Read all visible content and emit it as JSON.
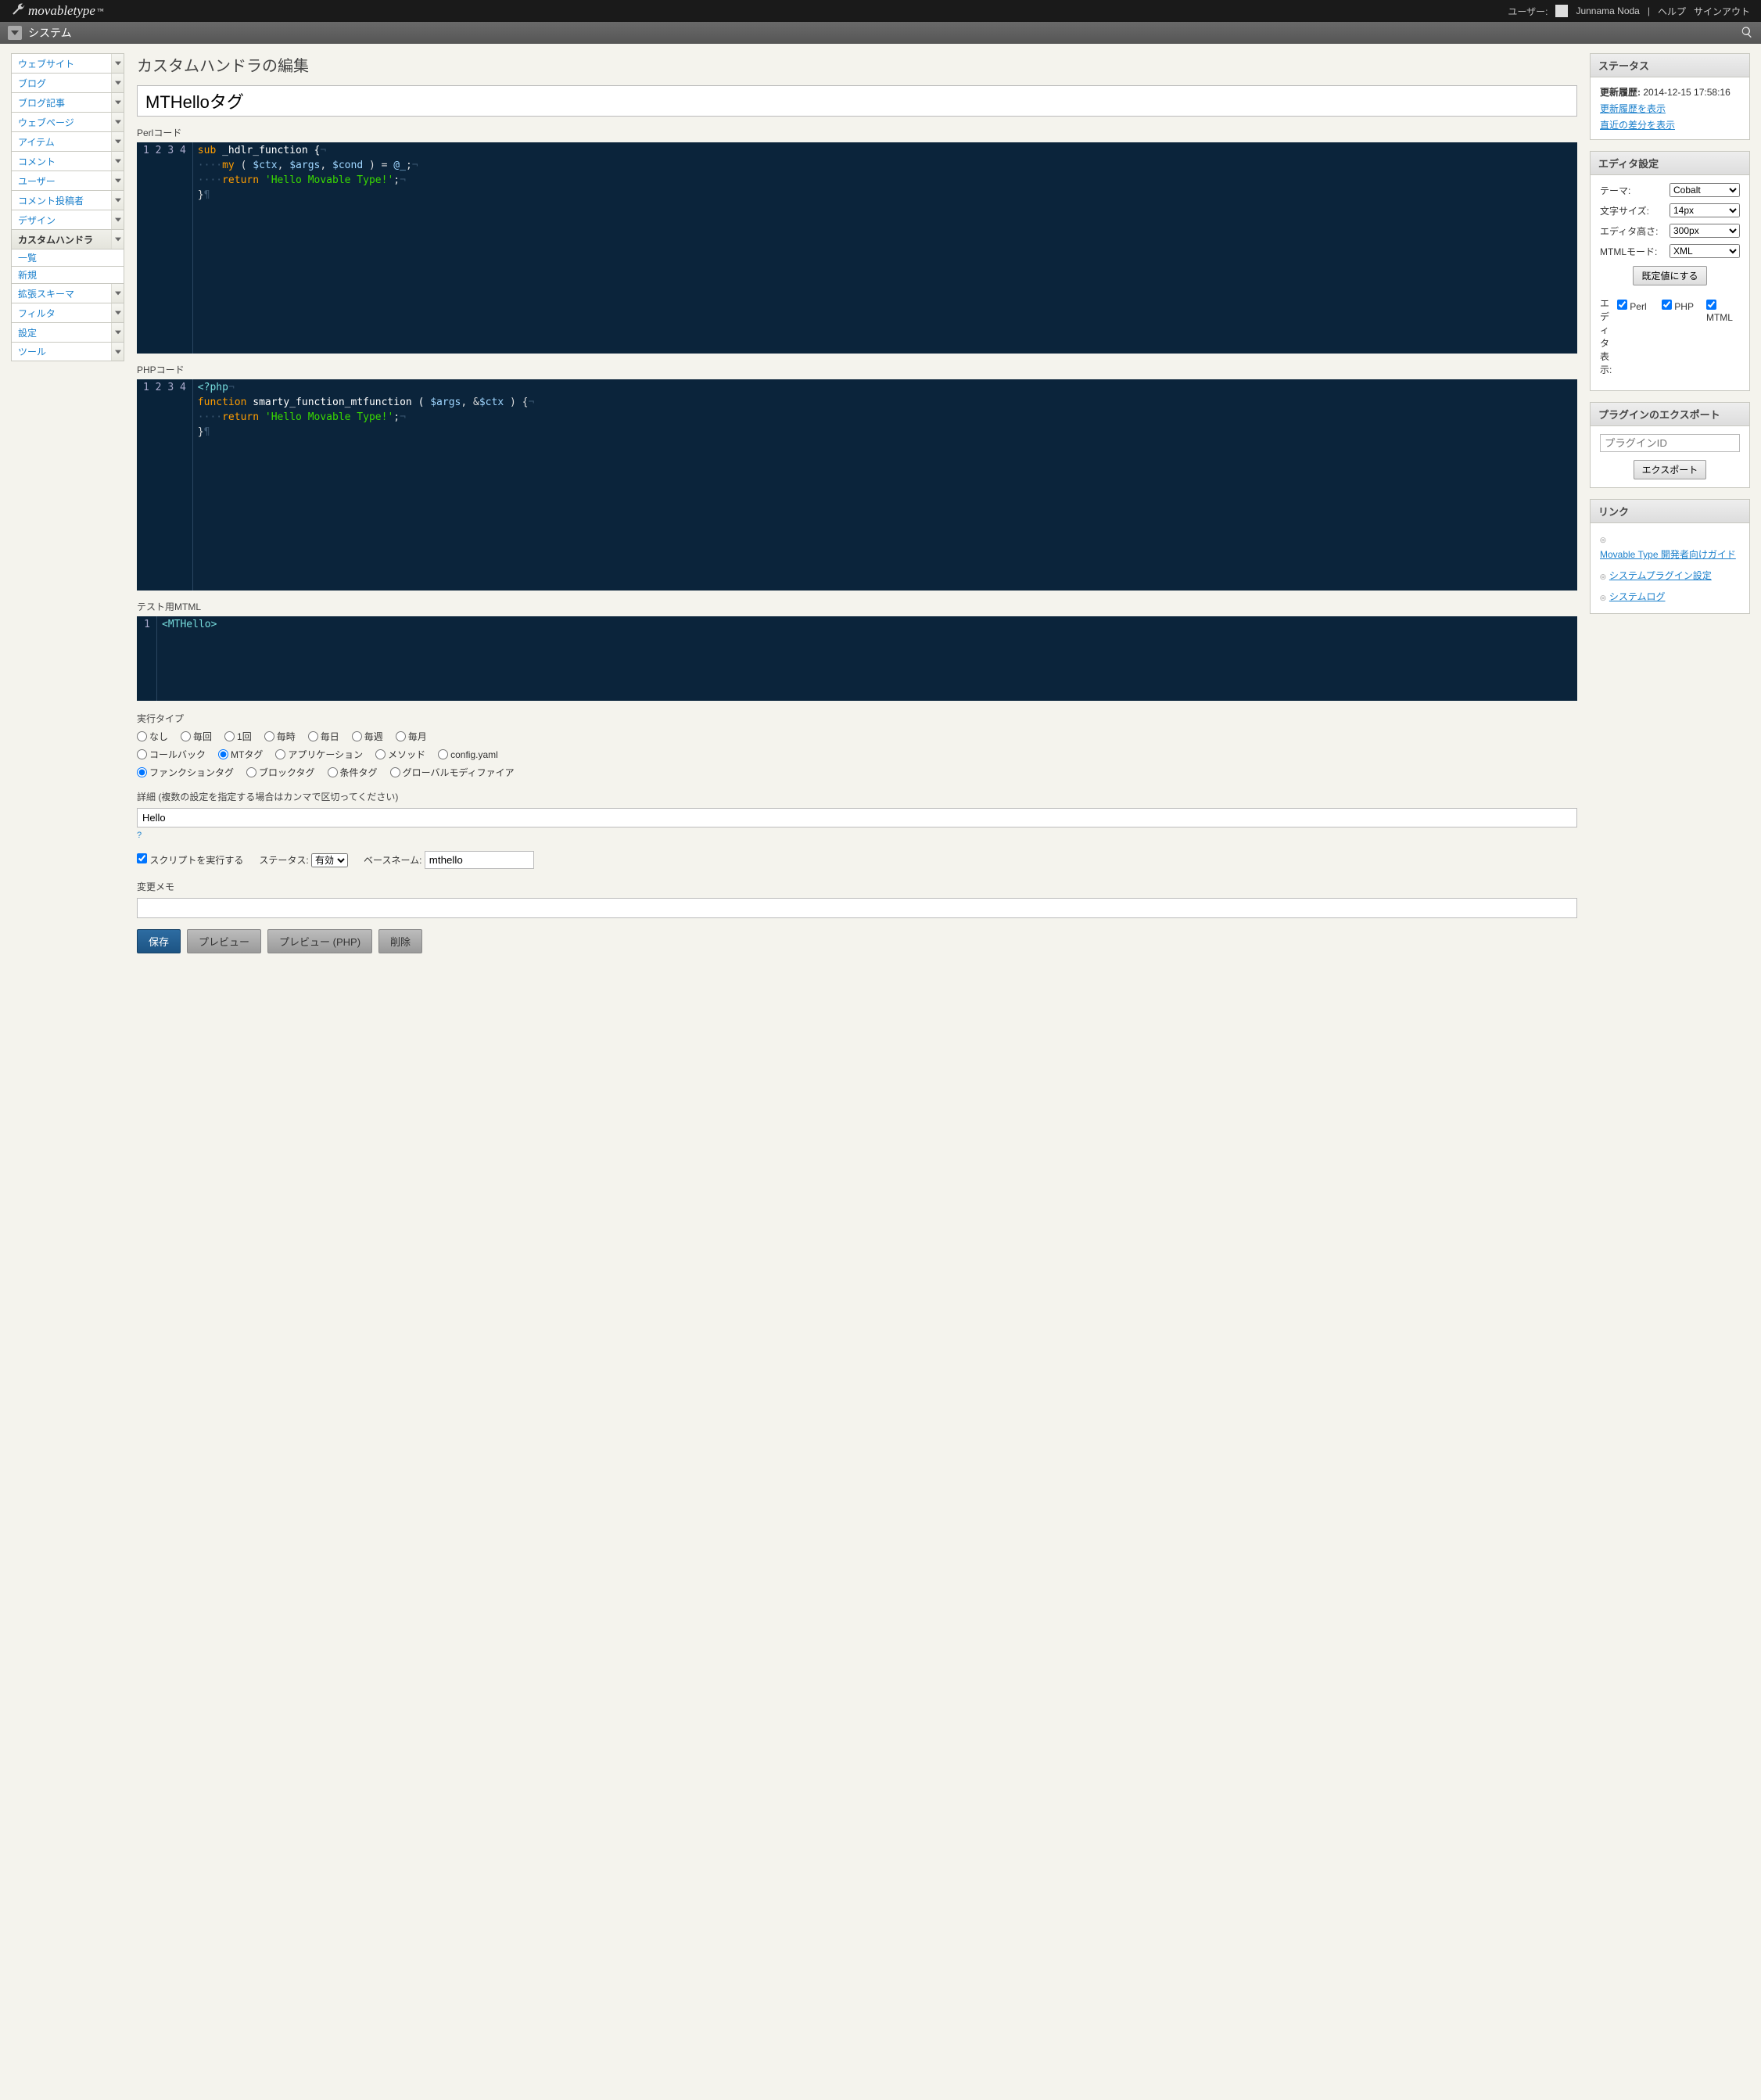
{
  "topbar": {
    "logo_text": "movabletype",
    "user_prefix": "ユーザー:",
    "username": "Junnama Noda",
    "help": "ヘルプ",
    "signout": "サインアウト"
  },
  "subbar": {
    "title": "システム"
  },
  "sidebar": [
    {
      "label": "ウェブサイト",
      "kind": "item"
    },
    {
      "label": "ブログ",
      "kind": "item"
    },
    {
      "label": "ブログ記事",
      "kind": "item"
    },
    {
      "label": "ウェブページ",
      "kind": "item"
    },
    {
      "label": "アイテム",
      "kind": "item"
    },
    {
      "label": "コメント",
      "kind": "item"
    },
    {
      "label": "ユーザー",
      "kind": "item"
    },
    {
      "label": "コメント投稿者",
      "kind": "item"
    },
    {
      "label": "デザイン",
      "kind": "item"
    },
    {
      "label": "カスタムハンドラ",
      "kind": "active"
    },
    {
      "label": "一覧",
      "kind": "sub"
    },
    {
      "label": "新規",
      "kind": "sub"
    },
    {
      "label": "拡張スキーマ",
      "kind": "item"
    },
    {
      "label": "フィルタ",
      "kind": "item"
    },
    {
      "label": "設定",
      "kind": "item"
    },
    {
      "label": "ツール",
      "kind": "item"
    }
  ],
  "page": {
    "heading": "カスタムハンドラの編集",
    "title_value": "MTHelloタグ",
    "perl_label": "Perlコード",
    "php_label": "PHPコード",
    "mtml_label": "テスト用MTML",
    "perl_code": {
      "lines": [
        "1",
        "2",
        "3",
        "4"
      ],
      "l1a": "sub",
      "l1b": " _hdlr_function {",
      "l2a": "    ",
      "l2b": "my",
      "l2c": " ( ",
      "l2d": "$ctx",
      "l2e": ", ",
      "l2f": "$args",
      "l2g": ", ",
      "l2h": "$cond",
      "l2i": " ) = ",
      "l2j": "@_",
      "l2k": ";",
      "l3a": "    ",
      "l3b": "return",
      "l3c": " ",
      "l3d": "'Hello Movable Type!'",
      "l3e": ";",
      "l4a": "}"
    },
    "php_code": {
      "lines": [
        "1",
        "2",
        "3",
        "4"
      ],
      "l1": "<?php",
      "l2a": "function",
      "l2b": " smarty_function_mtfunction ( ",
      "l2c": "$args",
      "l2d": ", &",
      "l2e": "$ctx",
      "l2f": " ) {",
      "l3a": "    ",
      "l3b": "return",
      "l3c": " ",
      "l3d": "'Hello Movable Type!'",
      "l3e": ";",
      "l4a": "}"
    },
    "mtml_code": {
      "lines": [
        "1"
      ],
      "l1": "<MTHello>"
    },
    "exec_type_label": "実行タイプ",
    "exec_row1": [
      "なし",
      "毎回",
      "1回",
      "毎時",
      "毎日",
      "毎週",
      "毎月"
    ],
    "exec_row2": [
      "コールバック",
      "MTタグ",
      "アプリケーション",
      "メソッド",
      "config.yaml"
    ],
    "exec_row2_selected": "MTタグ",
    "exec_row3": [
      "ファンクションタグ",
      "ブロックタグ",
      "条件タグ",
      "グローバルモディファイア"
    ],
    "exec_row3_selected": "ファンクションタグ",
    "detail_label": "詳細 (複数の設定を指定する場合はカンマで区切ってください)",
    "detail_value": "Hello",
    "help_q": "?",
    "run_script_label": "スクリプトを実行する",
    "status_label": "ステータス:",
    "status_value": "有効",
    "basename_label": "ベースネーム:",
    "basename_value": "mthello",
    "memo_label": "変更メモ",
    "memo_value": "",
    "buttons": {
      "save": "保存",
      "preview": "プレビュー",
      "preview_php": "プレビュー (PHP)",
      "delete": "削除"
    }
  },
  "right": {
    "status": {
      "title": "ステータス",
      "history_label": "更新履歴:",
      "history_value": "2014-12-15 17:58:16",
      "link1": "更新履歴を表示",
      "link2": "直近の差分を表示"
    },
    "editor": {
      "title": "エディタ設定",
      "theme_label": "テーマ:",
      "theme_value": "Cobalt",
      "font_label": "文字サイズ:",
      "font_value": "14px",
      "height_label": "エディタ高さ:",
      "height_value": "300px",
      "mtml_label": "MTMLモード:",
      "mtml_value": "XML",
      "default_btn": "既定値にする",
      "display_label": "エディタ表示:",
      "cb_perl": "Perl",
      "cb_php": "PHP",
      "cb_mtml": "MTML"
    },
    "export": {
      "title": "プラグインのエクスポート",
      "placeholder": "プラグインID",
      "btn": "エクスポート"
    },
    "links": {
      "title": "リンク",
      "l1": "Movable Type 開発者向けガイド",
      "l2": "システムプラグイン設定",
      "l3": "システムログ"
    }
  }
}
